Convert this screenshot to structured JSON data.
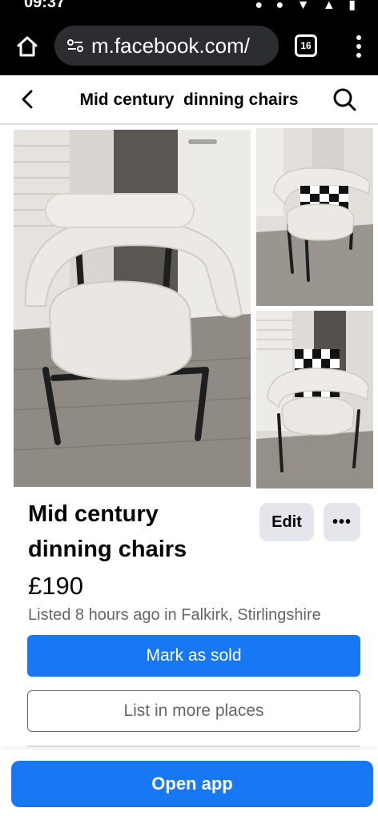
{
  "status_bar": {
    "time": "09:37",
    "icons": "● ● ▼ ▲ ▮"
  },
  "browser": {
    "url": "m.facebook.com/",
    "tab_count": "16",
    "icons": [
      "home-icon",
      "site-settings-icon",
      "tabs-icon",
      "more-vertical-icon"
    ]
  },
  "header": {
    "title": "Mid century  dinning chairs",
    "icons": [
      "back-arrow-icon",
      "search-icon"
    ]
  },
  "photos": [
    {
      "alt": "Cream boucle chair with black legs",
      "position": "main"
    },
    {
      "alt": "Chair with black and white checkered cushion",
      "position": "top-right"
    },
    {
      "alt": "Chair with checkered cushion by window",
      "position": "bottom-right"
    }
  ],
  "listing": {
    "title": "Mid century dinning chairs",
    "price": "£190",
    "listed_info": "Listed 8 hours ago in Falkirk, Stirlingshire",
    "edit_label": "Edit",
    "more_label": "•••",
    "mark_sold_label": "Mark as sold",
    "more_places_label": "List in more places"
  },
  "bottom": {
    "open_app_label": "Open app"
  },
  "colors": {
    "primary_blue": "#1877f2",
    "secondary_bg": "#e4e6eb",
    "muted_text": "#65676b",
    "browser_bg": "#000000"
  }
}
